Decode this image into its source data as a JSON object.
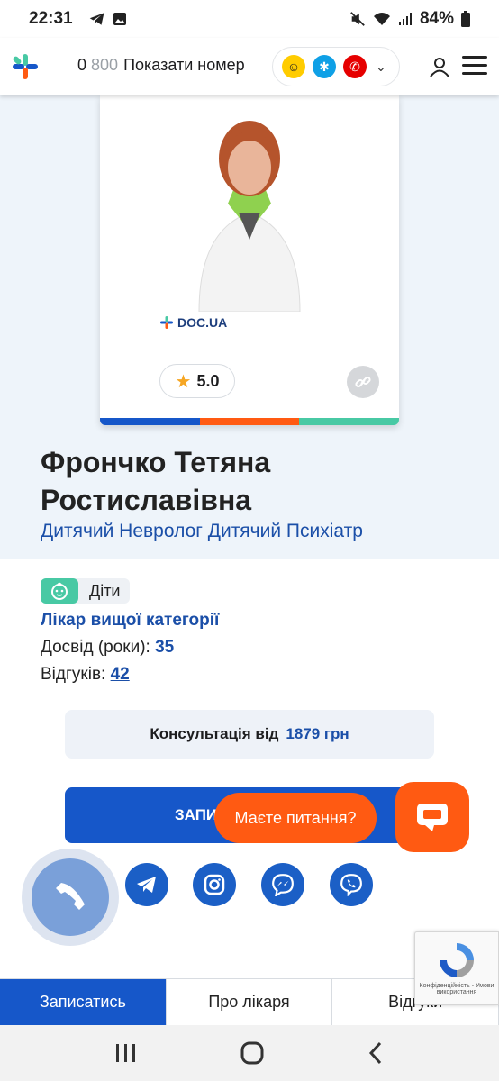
{
  "status_bar": {
    "time": "22:31",
    "battery": "84%"
  },
  "header": {
    "phone_prefix": "0",
    "phone_grey": "800",
    "phone_action": "Показати номер",
    "operators": [
      "lifecell-icon",
      "kyivstar-icon",
      "vodafone-icon"
    ]
  },
  "card": {
    "rating": "5.0",
    "logo_text": "DOC.UA",
    "stripe_colors": [
      "#1657c9",
      "#ff5a12",
      "#48c9a4"
    ]
  },
  "doctor": {
    "name": "Фрончко Тетяна Ростиславівна",
    "specialty": "Дитячий Невролог Дитячий Психіатр",
    "tag": "Діти",
    "category": "Лікар вищої категорії",
    "experience_label": "Досвід (роки):",
    "experience_value": "35",
    "reviews_label": "Відгуків:",
    "reviews_value": "42"
  },
  "consult": {
    "label": "Консультація від",
    "price": "1879 грн"
  },
  "book": {
    "label_visible": "ЗАПИ"
  },
  "chat": {
    "question": "Маєте питання?"
  },
  "socials": [
    "telegram-icon",
    "instagram-icon",
    "messenger-icon",
    "viber-icon"
  ],
  "recaptcha": {
    "text": "Конфіденційність - Умови використання"
  },
  "tabs": [
    {
      "label": "Записатись",
      "active": true
    },
    {
      "label": "Про лікаря",
      "active": false
    },
    {
      "label": "Відгуки",
      "active": false
    }
  ],
  "colors": {
    "accent": "#1657c9",
    "orange": "#ff5a12",
    "green": "#48c9a4",
    "hero_bg": "#eef4fa"
  }
}
